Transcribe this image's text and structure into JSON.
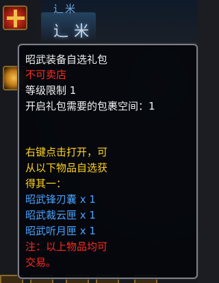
{
  "colors": {
    "title": "#f2f2f2",
    "warning": "#ff2b1f",
    "description": "#ffd21e",
    "item_link": "#4aa3ff"
  },
  "background": {
    "name_small": "辶米",
    "name_large": "辶米"
  },
  "slots": {
    "gift_icon": "gift-box-icon",
    "moon_icon": "moon-orb-icon"
  },
  "tooltip": {
    "title": "昭武装备自选礼包",
    "not_sellable": "不可卖店",
    "level_limit": "等级限制 1",
    "bag_space": "开启礼包需要的包裹空间：1",
    "desc_line1": "右键点击打开，可",
    "desc_line2": "从以下物品自选获",
    "desc_line3": "得其一：",
    "items": [
      "昭武锋刃囊 x 1",
      "昭武裁云匣 x 1",
      "昭武听月匣 x 1"
    ],
    "note_line1": "注：以上物品均可",
    "note_line2": "交易。"
  }
}
